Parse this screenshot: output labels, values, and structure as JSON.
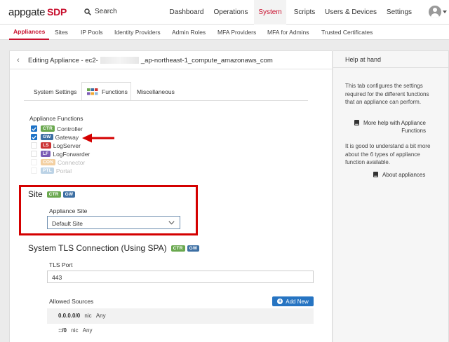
{
  "brand": {
    "name": "appgate",
    "suffix": "SDP"
  },
  "search": {
    "label": "Search"
  },
  "topnav": [
    {
      "label": "Dashboard",
      "active": false
    },
    {
      "label": "Operations",
      "active": false
    },
    {
      "label": "System",
      "active": true
    },
    {
      "label": "Scripts",
      "active": false
    },
    {
      "label": "Users & Devices",
      "active": false
    },
    {
      "label": "Settings",
      "active": false
    }
  ],
  "subnav": [
    {
      "label": "Appliances",
      "active": true
    },
    {
      "label": "Sites",
      "active": false
    },
    {
      "label": "IP Pools",
      "active": false
    },
    {
      "label": "Identity Providers",
      "active": false
    },
    {
      "label": "Admin Roles",
      "active": false
    },
    {
      "label": "MFA Providers",
      "active": false
    },
    {
      "label": "MFA for Admins",
      "active": false
    },
    {
      "label": "Trusted Certificates",
      "active": false
    }
  ],
  "editor": {
    "title_prefix": "Editing Appliance - ec2-",
    "title_suffix": "_ap-northeast-1_compute_amazonaws_com"
  },
  "tabs": [
    {
      "label": "System Settings",
      "active": false
    },
    {
      "label": "Functions",
      "active": true
    },
    {
      "label": "Miscellaneous",
      "active": false
    }
  ],
  "functions": {
    "heading": "Appliance Functions",
    "items": [
      {
        "code": "CTR",
        "label": "Controller",
        "checked": true,
        "enabled": true,
        "color": "#6aa84f"
      },
      {
        "code": "GW",
        "label": "Gateway",
        "checked": true,
        "enabled": true,
        "color": "#3d6fa3"
      },
      {
        "code": "LS",
        "label": "LogServer",
        "checked": false,
        "enabled": true,
        "color": "#cc3333"
      },
      {
        "code": "LF",
        "label": "LogForwarder",
        "checked": false,
        "enabled": true,
        "color": "#7b5bb5"
      },
      {
        "code": "CON",
        "label": "Connector",
        "checked": false,
        "enabled": false,
        "color": "#f3cfa0"
      },
      {
        "code": "PTL",
        "label": "Portal",
        "checked": false,
        "enabled": false,
        "color": "#bcd3e6"
      }
    ]
  },
  "site": {
    "heading": "Site",
    "badges": [
      "CTR",
      "GW"
    ],
    "field_label": "Appliance Site",
    "selected": "Default Site"
  },
  "tls": {
    "heading": "System TLS Connection (Using SPA)",
    "badges": [
      "CTR",
      "GW"
    ],
    "port_label": "TLS Port",
    "port_value": "443",
    "sources_label": "Allowed Sources",
    "add_label": "Add New",
    "sources": [
      {
        "address": "0.0.0.0/0",
        "nic": "nic",
        "any": "Any"
      },
      {
        "address": "::/0",
        "nic": "nic",
        "any": "Any"
      }
    ]
  },
  "help": {
    "heading": "Help at hand",
    "p1": "This tab configures the settings required for the different functions that an appliance can perform.",
    "link1_a": "More help with Appliance",
    "link1_b": "Functions",
    "p2": "It is good to understand a bit more about the 6 types of appliance function available.",
    "link2": "About appliances"
  },
  "colors": {
    "accent": "#c8102e",
    "highlight_box": "#d40000",
    "primary_button": "#2674c2",
    "ctr": "#6aa84f",
    "gw": "#3d6fa3"
  }
}
